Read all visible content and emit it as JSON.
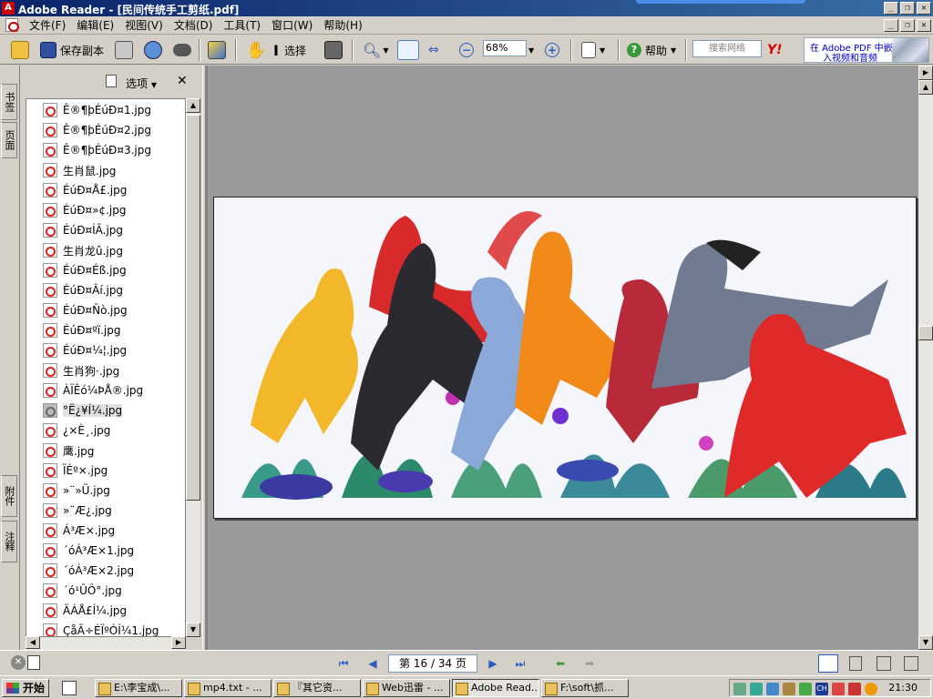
{
  "window": {
    "title": "Adobe Reader - [民间传统手工剪纸.pdf]"
  },
  "menu": {
    "items": [
      "文件(F)",
      "编辑(E)",
      "视图(V)",
      "文档(D)",
      "工具(T)",
      "窗口(W)",
      "帮助(H)"
    ]
  },
  "toolbar": {
    "save_copy_label": "保存副本",
    "select_label": "选择",
    "zoom_value": "68%",
    "help_label": "帮助",
    "search_placeholder": "搜索网络",
    "ad_line1": "在 Adobe PDF 中嵌",
    "ad_line2": "入视频和音频"
  },
  "left_tabs": [
    "书签",
    "页面",
    "附件",
    "注释"
  ],
  "panel": {
    "options_label": "选项",
    "files": [
      "Ê®¶þÉúÐ¤1.jpg",
      "Ê®¶þÉúÐ¤2.jpg",
      "Ê®¶þÉúÐ¤3.jpg",
      "生肖鼠.jpg",
      "ÉúÐ¤Å£.jpg",
      "ÉúÐ¤»¢.jpg",
      "ÉúÐ¤ÍÃ.jpg",
      "生肖龙û.jpg",
      "ÉúÐ¤Éß.jpg",
      "ÉúÐ¤Âí.jpg",
      "ÉúÐ¤Ñò.jpg",
      "ÉúÐ¤ºï.jpg",
      "ÉúÐ¤¼¦.jpg",
      "生肖狗·.jpg",
      "ÀÏÊó¼ÞÅ®.jpg",
      "°Ë¿¥Í¼.jpg",
      "¿×È¸.jpg",
      "鹰.jpg",
      "ÏÉº×.jpg",
      "»¨»Ü.jpg",
      "»¨Æ¿.jpg",
      "Á³Æ×.jpg",
      "´óÁ³Æ×1.jpg",
      "´óÁ³Æ×2.jpg",
      "´ó¹ÛÔ°.jpg",
      "ÄÁÅ£Í¼.jpg",
      "ÇåÃ÷ÉÏºÓÍ¼1.jpg"
    ],
    "selected_index": 15
  },
  "statusbar": {
    "page_indicator": "第 16 / 34 页"
  },
  "taskbar": {
    "start_label": "开始",
    "tasks": [
      "E:\\李宝成\\...",
      "mp4.txt - ...",
      "『其它资...",
      "Web迅雷 - ...",
      "Adobe Read...",
      "F:\\soft\\抓..."
    ],
    "active_task": 4,
    "clock": "21:30",
    "ime_label": "CH"
  },
  "colors": {
    "title_bar": "#0a246a",
    "accent_blue": "#2a5bc0",
    "pdf_red": "#cc0000"
  }
}
